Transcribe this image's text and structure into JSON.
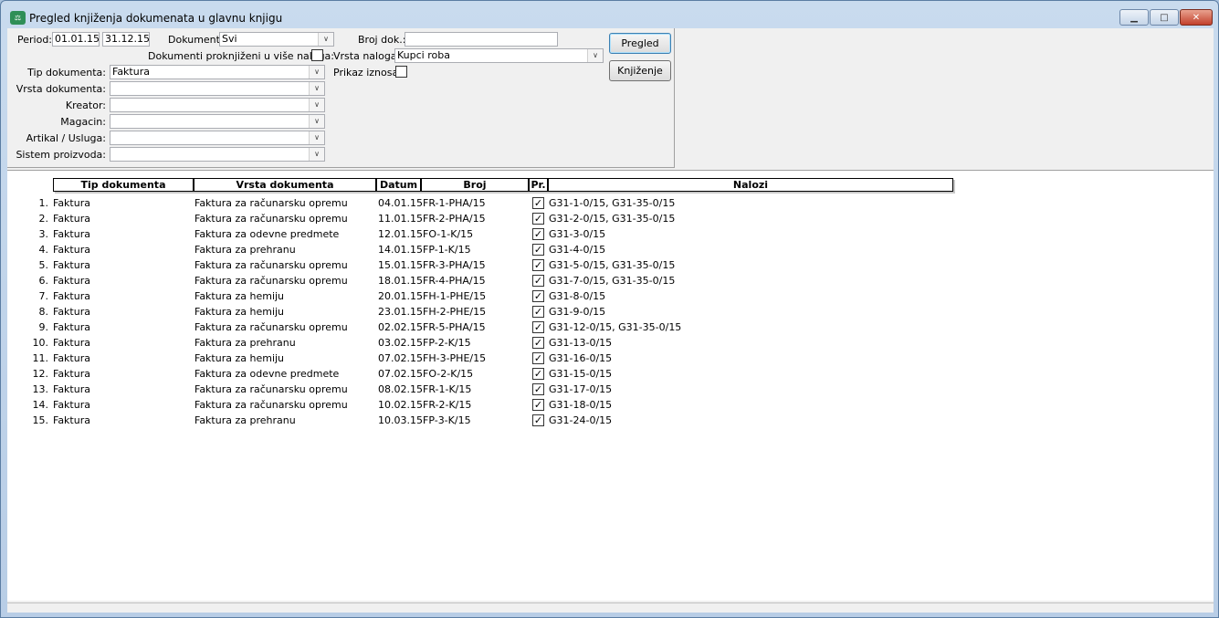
{
  "window": {
    "title": "Pregled knjiženja dokumenata u glavnu knjigu",
    "icon": "ledger-app-icon",
    "controls": {
      "minimize": "▁",
      "maximize": "□",
      "close": "✕"
    }
  },
  "filters": {
    "period_label": "Period:",
    "period_from": "01.01.15",
    "period_to": "31.12.15",
    "dokumenti_label": "Dokumenti:",
    "dokumenti_value": "Svi",
    "broj_dok_label": "Broj dok.:",
    "broj_dok_value": "",
    "proknjizeni_label": "Dokumenti proknjiženi u više naloga:",
    "proknjizeni_checked": false,
    "vrsta_naloga_label": "Vrsta naloga:",
    "vrsta_naloga_value": "Kupci roba",
    "prikaz_iznosa_label": "Prikaz iznosa:",
    "prikaz_iznosa_checked": false,
    "tip_dokumenta_label": "Tip dokumenta:",
    "tip_dokumenta_value": "Faktura",
    "vrsta_dokumenta_label": "Vrsta dokumenta:",
    "vrsta_dokumenta_value": "",
    "kreator_label": "Kreator:",
    "kreator_value": "",
    "magacin_label": "Magacin:",
    "magacin_value": "",
    "artikal_label": "Artikal / Usluga:",
    "artikal_value": "",
    "sistem_label": "Sistem proizvoda:",
    "sistem_value": ""
  },
  "buttons": {
    "pregled": "Pregled",
    "knjizenje": "Knjiženje"
  },
  "grid": {
    "columns": [
      "Tip dokumenta",
      "Vrsta dokumenta",
      "Datum",
      "Broj",
      "Pr.",
      "Nalozi"
    ],
    "rows": [
      {
        "n": "1.",
        "tip": "Faktura",
        "vrsta": "Faktura za računarsku opremu",
        "datum": "04.01.15",
        "broj": "FR-1-PHA/15",
        "pr": true,
        "nalozi": "G31-1-0/15, G31-35-0/15"
      },
      {
        "n": "2.",
        "tip": "Faktura",
        "vrsta": "Faktura za računarsku opremu",
        "datum": "11.01.15",
        "broj": "FR-2-PHA/15",
        "pr": true,
        "nalozi": "G31-2-0/15, G31-35-0/15"
      },
      {
        "n": "3.",
        "tip": "Faktura",
        "vrsta": "Faktura za odevne predmete",
        "datum": "12.01.15",
        "broj": "FO-1-K/15",
        "pr": true,
        "nalozi": "G31-3-0/15"
      },
      {
        "n": "4.",
        "tip": "Faktura",
        "vrsta": "Faktura za prehranu",
        "datum": "14.01.15",
        "broj": "FP-1-K/15",
        "pr": true,
        "nalozi": "G31-4-0/15"
      },
      {
        "n": "5.",
        "tip": "Faktura",
        "vrsta": "Faktura za računarsku opremu",
        "datum": "15.01.15",
        "broj": "FR-3-PHA/15",
        "pr": true,
        "nalozi": "G31-5-0/15, G31-35-0/15"
      },
      {
        "n": "6.",
        "tip": "Faktura",
        "vrsta": "Faktura za računarsku opremu",
        "datum": "18.01.15",
        "broj": "FR-4-PHA/15",
        "pr": true,
        "nalozi": "G31-7-0/15, G31-35-0/15"
      },
      {
        "n": "7.",
        "tip": "Faktura",
        "vrsta": "Faktura za hemiju",
        "datum": "20.01.15",
        "broj": "FH-1-PHE/15",
        "pr": true,
        "nalozi": "G31-8-0/15"
      },
      {
        "n": "8.",
        "tip": "Faktura",
        "vrsta": "Faktura za hemiju",
        "datum": "23.01.15",
        "broj": "FH-2-PHE/15",
        "pr": true,
        "nalozi": "G31-9-0/15"
      },
      {
        "n": "9.",
        "tip": "Faktura",
        "vrsta": "Faktura za računarsku opremu",
        "datum": "02.02.15",
        "broj": "FR-5-PHA/15",
        "pr": true,
        "nalozi": "G31-12-0/15, G31-35-0/15"
      },
      {
        "n": "10.",
        "tip": "Faktura",
        "vrsta": "Faktura za prehranu",
        "datum": "03.02.15",
        "broj": "FP-2-K/15",
        "pr": true,
        "nalozi": "G31-13-0/15"
      },
      {
        "n": "11.",
        "tip": "Faktura",
        "vrsta": "Faktura za hemiju",
        "datum": "07.02.15",
        "broj": "FH-3-PHE/15",
        "pr": true,
        "nalozi": "G31-16-0/15"
      },
      {
        "n": "12.",
        "tip": "Faktura",
        "vrsta": "Faktura za odevne predmete",
        "datum": "07.02.15",
        "broj": "FO-2-K/15",
        "pr": true,
        "nalozi": "G31-15-0/15"
      },
      {
        "n": "13.",
        "tip": "Faktura",
        "vrsta": "Faktura za računarsku opremu",
        "datum": "08.02.15",
        "broj": "FR-1-K/15",
        "pr": true,
        "nalozi": "G31-17-0/15"
      },
      {
        "n": "14.",
        "tip": "Faktura",
        "vrsta": "Faktura za računarsku opremu",
        "datum": "10.02.15",
        "broj": "FR-2-K/15",
        "pr": true,
        "nalozi": "G31-18-0/15"
      },
      {
        "n": "15.",
        "tip": "Faktura",
        "vrsta": "Faktura za prehranu",
        "datum": "10.03.15",
        "broj": "FP-3-K/15",
        "pr": true,
        "nalozi": "G31-24-0/15"
      }
    ]
  }
}
